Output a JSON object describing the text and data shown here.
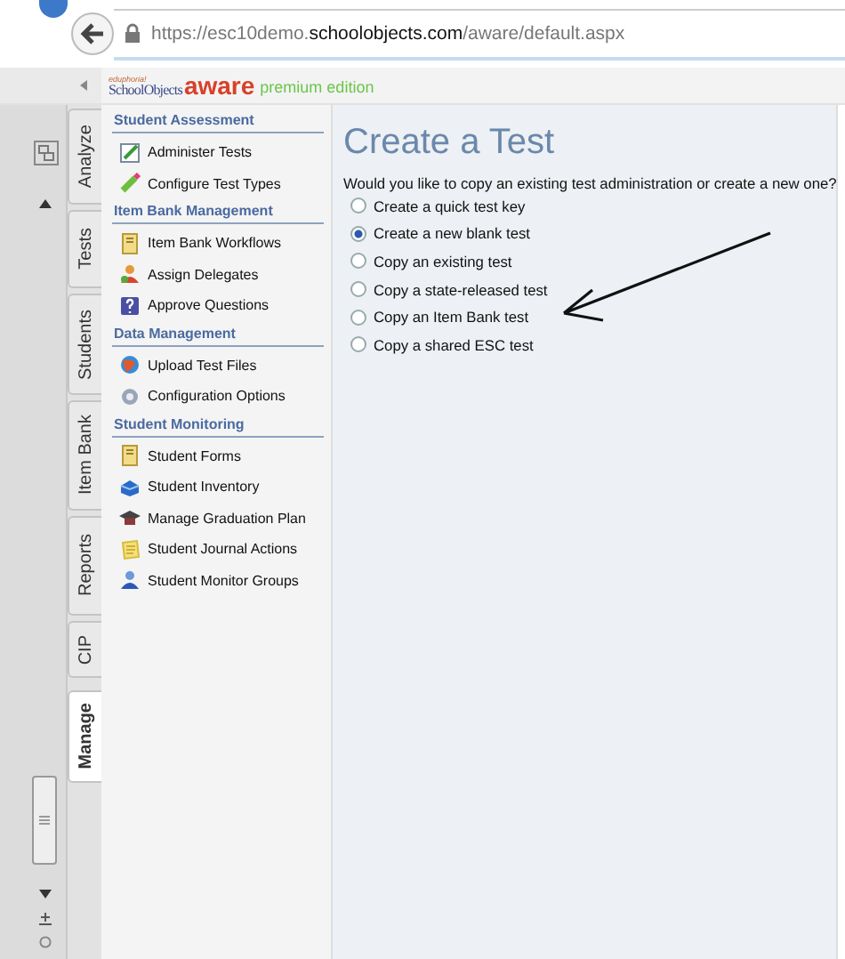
{
  "browser": {
    "url": {
      "scheme_host": "https://esc10demo.",
      "domain": "schoolobjects.com",
      "path": "/aware/default.aspx"
    }
  },
  "header": {
    "logo": {
      "small": "eduphoria!",
      "brand": "SchoolObjects",
      "product": "aware",
      "edition": "premium edition"
    }
  },
  "tabs": [
    {
      "label": "Analyze",
      "selected": false
    },
    {
      "label": "Tests",
      "selected": false
    },
    {
      "label": "Students",
      "selected": false
    },
    {
      "label": "Item Bank",
      "selected": false
    },
    {
      "label": "Reports",
      "selected": false
    },
    {
      "label": "CIP",
      "selected": false
    },
    {
      "label": "Manage",
      "selected": true
    }
  ],
  "menu": [
    {
      "heading": "Student Assessment",
      "items": [
        "Administer Tests",
        "Configure Test Types"
      ]
    },
    {
      "heading": "Item Bank Management",
      "items": [
        "Item Bank Workflows",
        "Assign Delegates",
        "Approve Questions"
      ]
    },
    {
      "heading": "Data Management",
      "items": [
        "Upload Test Files",
        "Configuration Options"
      ]
    },
    {
      "heading": "Student Monitoring",
      "items": [
        "Student Forms",
        "Student Inventory",
        "Manage Graduation Plan",
        "Student Journal Actions",
        "Student Monitor Groups"
      ]
    }
  ],
  "content": {
    "title": "Create a Test",
    "question": "Would you like to copy an existing test administration or create a new one?",
    "options": [
      {
        "label": "Create a quick test key",
        "selected": false
      },
      {
        "label": "Create a new blank test",
        "selected": true
      },
      {
        "label": "Copy an existing test",
        "selected": false
      },
      {
        "label": "Copy a state-released test",
        "selected": false
      },
      {
        "label": "Copy an Item Bank test",
        "selected": false
      },
      {
        "label": "Copy a shared ESC test",
        "selected": false
      }
    ]
  }
}
